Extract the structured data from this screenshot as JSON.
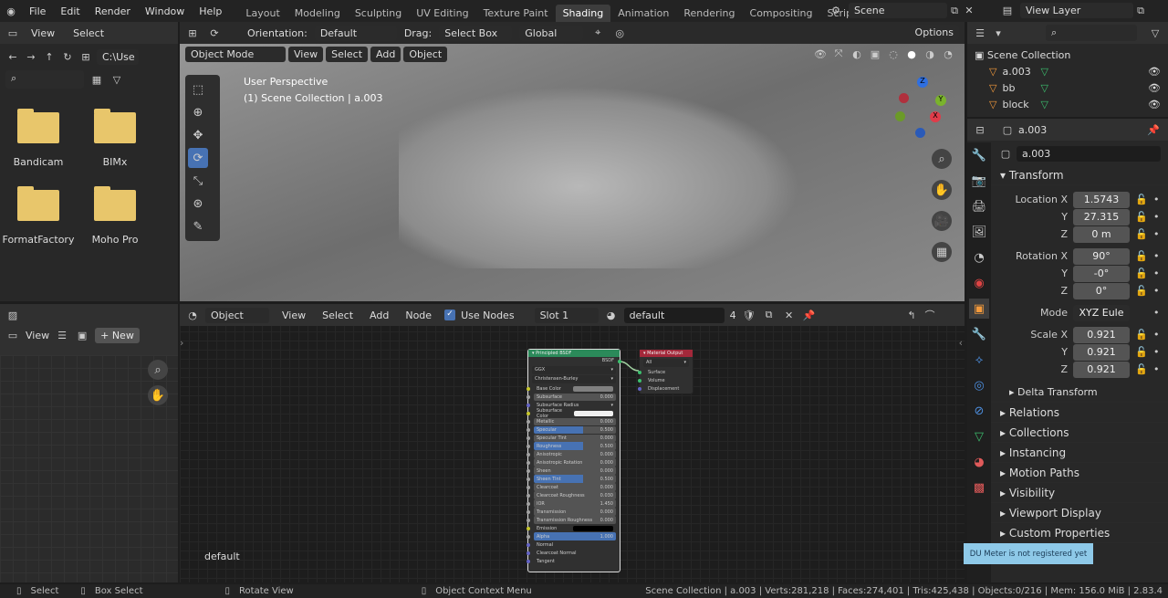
{
  "topbar": {
    "menus": [
      "File",
      "Edit",
      "Render",
      "Window",
      "Help"
    ],
    "workspaces": [
      "Layout",
      "Modeling",
      "Sculpting",
      "UV Editing",
      "Texture Paint",
      "Shading",
      "Animation",
      "Rendering",
      "Compositing",
      "Scripting"
    ],
    "active_workspace": "Shading",
    "scene": "Scene",
    "view_layer": "View Layer"
  },
  "filebrowser": {
    "menus": [
      "View",
      "Select"
    ],
    "path": "C:\\Use",
    "folders": [
      "Bandicam",
      "BIMx",
      "FormatFactory",
      "Moho Pro"
    ]
  },
  "viewport": {
    "orientation_label": "Orientation:",
    "orientation": "Default",
    "drag_label": "Drag:",
    "drag": "Select Box",
    "transform": "Global",
    "options": "Options",
    "mode": "Object Mode",
    "menus": [
      "View",
      "Select",
      "Add",
      "Object"
    ],
    "perspective": "User Perspective",
    "collection_info": "(1) Scene Collection | a.003",
    "gizmo": {
      "x": "X",
      "y": "Y",
      "z": "Z"
    }
  },
  "outliner": {
    "root": "Scene Collection",
    "items": [
      "a.003",
      "bb",
      "block"
    ]
  },
  "properties": {
    "object_name": "a.003",
    "data_name": "a.003",
    "transform_title": "Transform",
    "location": {
      "label": "Location X",
      "x": "1.5743",
      "y": "27.315",
      "z": "0 m"
    },
    "rotation": {
      "label": "Rotation X",
      "x": "90°",
      "y": "-0°",
      "z": "0°"
    },
    "mode_label": "Mode",
    "mode": "XYZ Eule",
    "scale": {
      "label": "Scale X",
      "x": "0.921",
      "y": "0.921",
      "z": "0.921"
    },
    "axis_y": "Y",
    "axis_z": "Z",
    "subpanel": "Delta Transform",
    "panels": [
      "Relations",
      "Collections",
      "Instancing",
      "Motion Paths",
      "Visibility",
      "Viewport Display",
      "Custom Properties"
    ]
  },
  "imageeditor": {
    "view": "View",
    "new": "New"
  },
  "nodeeditor": {
    "type": "Object",
    "menus": [
      "View",
      "Select",
      "Add",
      "Node"
    ],
    "use_nodes": "Use Nodes",
    "use_nodes_checked": true,
    "slot": "Slot 1",
    "material": "default",
    "users": "4",
    "material_label": "default",
    "bsdf": {
      "title": "Principled BSDF",
      "output": "BSDF",
      "distribution": "GGX",
      "subsurface_method": "Christensen-Burley",
      "inputs": [
        {
          "name": "Base Color",
          "type": "color",
          "color": "#808080"
        },
        {
          "name": "Subsurface",
          "value": "0.000"
        },
        {
          "name": "Subsurface Radius",
          "type": "dropdown"
        },
        {
          "name": "Subsurface Color",
          "type": "color",
          "color": "#f0f0f0"
        },
        {
          "name": "Metallic",
          "value": "0.000"
        },
        {
          "name": "Specular",
          "value": "0.500",
          "fill": 0.5
        },
        {
          "name": "Specular Tint",
          "value": "0.000"
        },
        {
          "name": "Roughness",
          "value": "0.500",
          "fill": 0.5
        },
        {
          "name": "Anisotropic",
          "value": "0.000"
        },
        {
          "name": "Anisotropic Rotation",
          "value": "0.000"
        },
        {
          "name": "Sheen",
          "value": "0.000"
        },
        {
          "name": "Sheen Tint",
          "value": "0.500",
          "fill": 0.5
        },
        {
          "name": "Clearcoat",
          "value": "0.000"
        },
        {
          "name": "Clearcoat Roughness",
          "value": "0.030"
        },
        {
          "name": "IOR",
          "value": "1.450"
        },
        {
          "name": "Transmission",
          "value": "0.000"
        },
        {
          "name": "Transmission Roughness",
          "value": "0.000"
        },
        {
          "name": "Emission",
          "type": "color",
          "color": "#000000"
        },
        {
          "name": "Alpha",
          "value": "1.000",
          "fill": 1
        },
        {
          "name": "Normal",
          "type": "socket"
        },
        {
          "name": "Clearcoat Normal",
          "type": "socket"
        },
        {
          "name": "Tangent",
          "type": "socket"
        }
      ]
    },
    "output": {
      "title": "Material Output",
      "target": "All",
      "inputs": [
        "Surface",
        "Volume",
        "Displacement"
      ]
    }
  },
  "statusbar": {
    "select": "Select",
    "box_select": "Box Select",
    "rotate": "Rotate View",
    "context": "Object Context Menu",
    "stats": "Scene Collection | a.003 | Verts:281,218 | Faces:274,401 | Tris:425,438 | Objects:0/216 | Mem: 156.0 MiB | 2.83.4"
  },
  "tooltip": "DU Meter is not registered yet",
  "colors": {
    "accent": "#4772b3",
    "bsdf_header": "#2b8a5a",
    "output_header": "#a3283a",
    "tooltip": "#8ec9e8"
  }
}
